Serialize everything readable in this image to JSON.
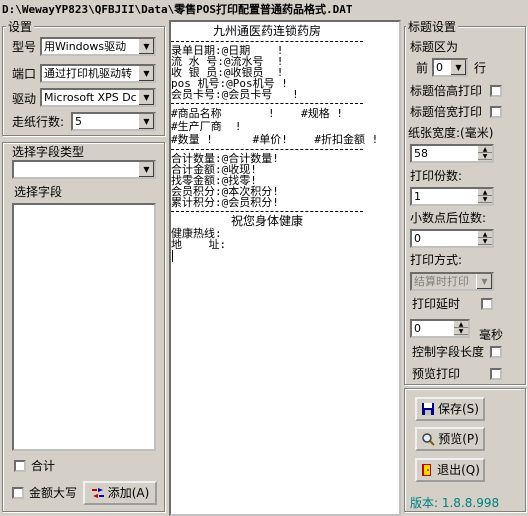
{
  "window": {
    "title": "D:\\WewayYP823\\QFBJII\\Data\\零售POS打印配置普通药品格式.DAT"
  },
  "settings": {
    "group_label": "设置",
    "model_label": "型号",
    "model_value": "用Windows驱动",
    "port_label": "端口",
    "port_value": "通过打印机驱动转",
    "driver_label": "驱动",
    "driver_value": "Microsoft XPS Dc",
    "feed_label": "走纸行数:",
    "feed_value": "5"
  },
  "fields": {
    "type_label": "选择字段类型",
    "type_value": "",
    "select_label": "选择字段",
    "total_label": "合计",
    "amount_upper_label": "金额大写",
    "add_button": "添加(A)"
  },
  "preview": {
    "title": "九州通医药连锁药房",
    "lines1": [
      "录单日期:@日期    !",
      "流 水 号:@流水号  !",
      "收 银 员:@收银员  !",
      "pos 机号:@Pos机号 !",
      "会员卡号:@会员卡号   !"
    ],
    "lines2": [
      "#商品名称       !    #规格 !",
      "#生产厂商  !",
      "#数量 !      #单价!    #折扣金额 !"
    ],
    "lines3": [
      "合计数量:@合计数量!",
      "合计金额:@收现!",
      "找零金额:@找零!",
      "会员积分:@本次积分!",
      "累计积分:@会员积分!"
    ],
    "footer": "祝您身体健康",
    "lines4": [
      "健康热线:",
      "地    址:"
    ]
  },
  "title_settings": {
    "group_label": "标题设置",
    "area_label": "标题区为",
    "front_label": "前",
    "front_value": "0",
    "rows_label": "行",
    "double_height_label": "标题倍高打印",
    "double_width_label": "标题倍宽打印",
    "paper_width_label": "纸张宽度:(毫米)",
    "paper_width_value": "58",
    "copies_label": "打印份数:",
    "copies_value": "1",
    "decimals_label": "小数点后位数:",
    "decimals_value": "0",
    "mode_label": "打印方式:",
    "mode_value": "结算时打印",
    "delay_label": "打印延时",
    "delay_value": "0",
    "delay_unit": "毫秒",
    "control_length_label": "控制字段长度",
    "preview_print_label": "预览打印"
  },
  "buttons": {
    "save": "保存(S)",
    "preview": "预览(P)",
    "exit": "退出(Q)"
  },
  "version": "版本: 1.8.8.998"
}
